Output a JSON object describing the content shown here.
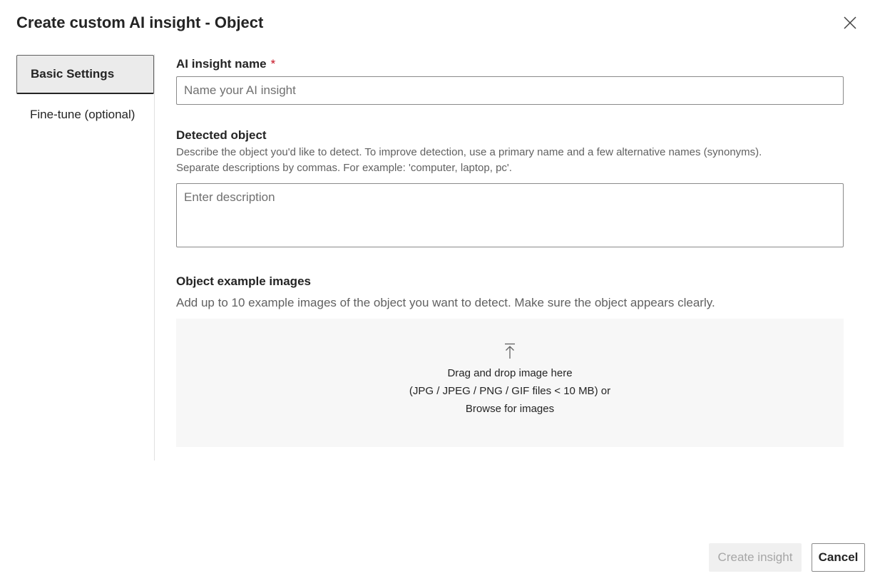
{
  "dialog": {
    "title": "Create custom AI insight - Object"
  },
  "nav": {
    "items": [
      {
        "label": "Basic Settings",
        "active": true
      },
      {
        "label": "Fine-tune (optional)",
        "active": false
      }
    ]
  },
  "form": {
    "name": {
      "label": "AI insight name",
      "required_mark": "*",
      "placeholder": "Name your AI insight",
      "value": ""
    },
    "detected_object": {
      "label": "Detected object",
      "help_line1": "Describe the object you'd like to detect. To improve detection, use a primary name and a few alternative names (synonyms).",
      "help_line2": "Separate descriptions by commas. For example: 'computer, laptop, pc'.",
      "placeholder": "Enter description",
      "value": ""
    },
    "images": {
      "label": "Object example images",
      "help": "Add up to 10 example images of the object you want to detect. Make sure the object appears clearly.",
      "dropzone": {
        "icon": "upload-icon",
        "line1": "Drag and drop image here",
        "line2": "(JPG / JPEG / PNG / GIF files < 10 MB) or",
        "browse": "Browse for images"
      }
    }
  },
  "footer": {
    "create_label": "Create insight",
    "cancel_label": "Cancel"
  },
  "colors": {
    "required": "#c50f1f",
    "disabled_text": "#a6a6a6",
    "dropzone_bg": "#f7f7f7"
  }
}
